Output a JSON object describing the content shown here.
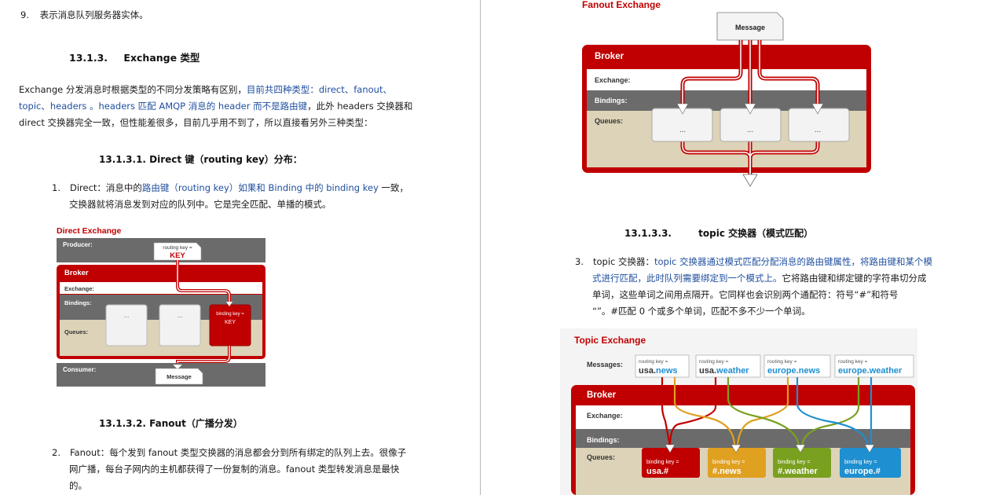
{
  "left_page": {
    "item9": {
      "num": "9.",
      "text": "表示消息队列服务器实体。"
    },
    "section_13_1_3": {
      "num": "13.1.3.",
      "title": "Exchange 类型"
    },
    "intro": {
      "line1_a": "Exchange 分发消息时根据类型的不同分发策略有区别，",
      "line1_b": "目前共四种类型：direct、fanout、",
      "line2_a": "topic、headers 。headers 匹配 AMQP 消息的 header 而不是路由键",
      "line2_b": "，此外 headers 交换器和",
      "line3": "direct 交换器完全一致，但性能差很多，目前几乎用不到了，所以直接看另外三种类型："
    },
    "section_direct": {
      "title": "13.1.3.1.  Direct 键（routing key）分布："
    },
    "item1": {
      "num": "1.",
      "line1_a": "Direct：消息中的",
      "line1_b": "路由键（routing key）如果和 Binding 中的 binding key",
      "line1_c": " 一致，",
      "line2": "交换器就将消息发到对应的队列中。它是完全匹配、单播的模式。"
    },
    "direct_diagram": {
      "title": "Direct Exchange",
      "producer_label": "Producer:",
      "routing_key_label": "routing key =",
      "routing_key_value": "KEY",
      "broker_label": "Broker",
      "exchange_label": "Exchange:",
      "bindings_label": "Bindings:",
      "queues_label": "Queues:",
      "queue_placeholder": "...",
      "binding_key_label": "binding key =",
      "binding_key_value": "KEY",
      "consumer_label": "Consumer:",
      "message_label": "Message"
    },
    "section_fanout": {
      "title": "13.1.3.2.  Fanout（广播分发）"
    },
    "item2": {
      "num": "2.",
      "line1": "Fanout：每个发到 fanout 类型交换器的消息都会分到所有绑定的队列上去。很像子",
      "line2": "网广播，每台子网内的主机都获得了一份复制的消息。fanout 类型转发消息是最快",
      "line3": "的。"
    }
  },
  "right_page": {
    "fanout_diagram": {
      "title": "Fanout Exchange",
      "message_label": "Message",
      "broker_label": "Broker",
      "exchange_label": "Exchange:",
      "bindings_label": "Bindings:",
      "queues_label": "Queues:",
      "queue_placeholder": "..."
    },
    "section_topic": {
      "num": "13.1.3.3.",
      "title": "topic 交换器（模式匹配）"
    },
    "item3": {
      "num": "3.",
      "line1_a": "topic 交换器：",
      "line1_b": "topic 交换器通过模式匹配分配消息的路由键属性，将路由键和某个模",
      "line2_a": "式进行匹配，此时队列需要绑定到一个模式上。",
      "line2_b": "它将路由键和绑定键的字符串切分成",
      "line3": "单词，这些单词之间用点隔开。它同样也会识别两个通配符：符号“#”和符号",
      "line4": "“”。#匹配 0 个或多个单词，匹配不多不少一个单词。"
    },
    "topic_diagram": {
      "title": "Topic Exchange",
      "messages_label": "Messages:",
      "routing_key_label": "routing key =",
      "messages": [
        {
          "prefix": "usa.",
          "suffix": "news"
        },
        {
          "prefix": "usa.",
          "suffix": "weather"
        },
        {
          "prefix": "europe.",
          "suffix": "news"
        },
        {
          "prefix": "europe.",
          "suffix": "weather"
        }
      ],
      "broker_label": "Broker",
      "exchange_label": "Exchange:",
      "bindings_label": "Bindings:",
      "queues_label": "Queues:",
      "binding_key_label": "binding key =",
      "queues": [
        {
          "key": "usa.#",
          "color": "#c00000"
        },
        {
          "key": "#.news",
          "color": "#e0a020"
        },
        {
          "key": "#.weather",
          "color": "#7aa020"
        },
        {
          "key": "europe.#",
          "color": "#1e8fd0"
        }
      ]
    }
  },
  "colors": {
    "link_blue": "#1f4e9e",
    "broker_red": "#c00000",
    "broker_header": "#b40d0d",
    "bindings_grey": "#6b6b6b",
    "queues_tan": "#dcd3b8",
    "exchange_white": "#ffffff"
  }
}
